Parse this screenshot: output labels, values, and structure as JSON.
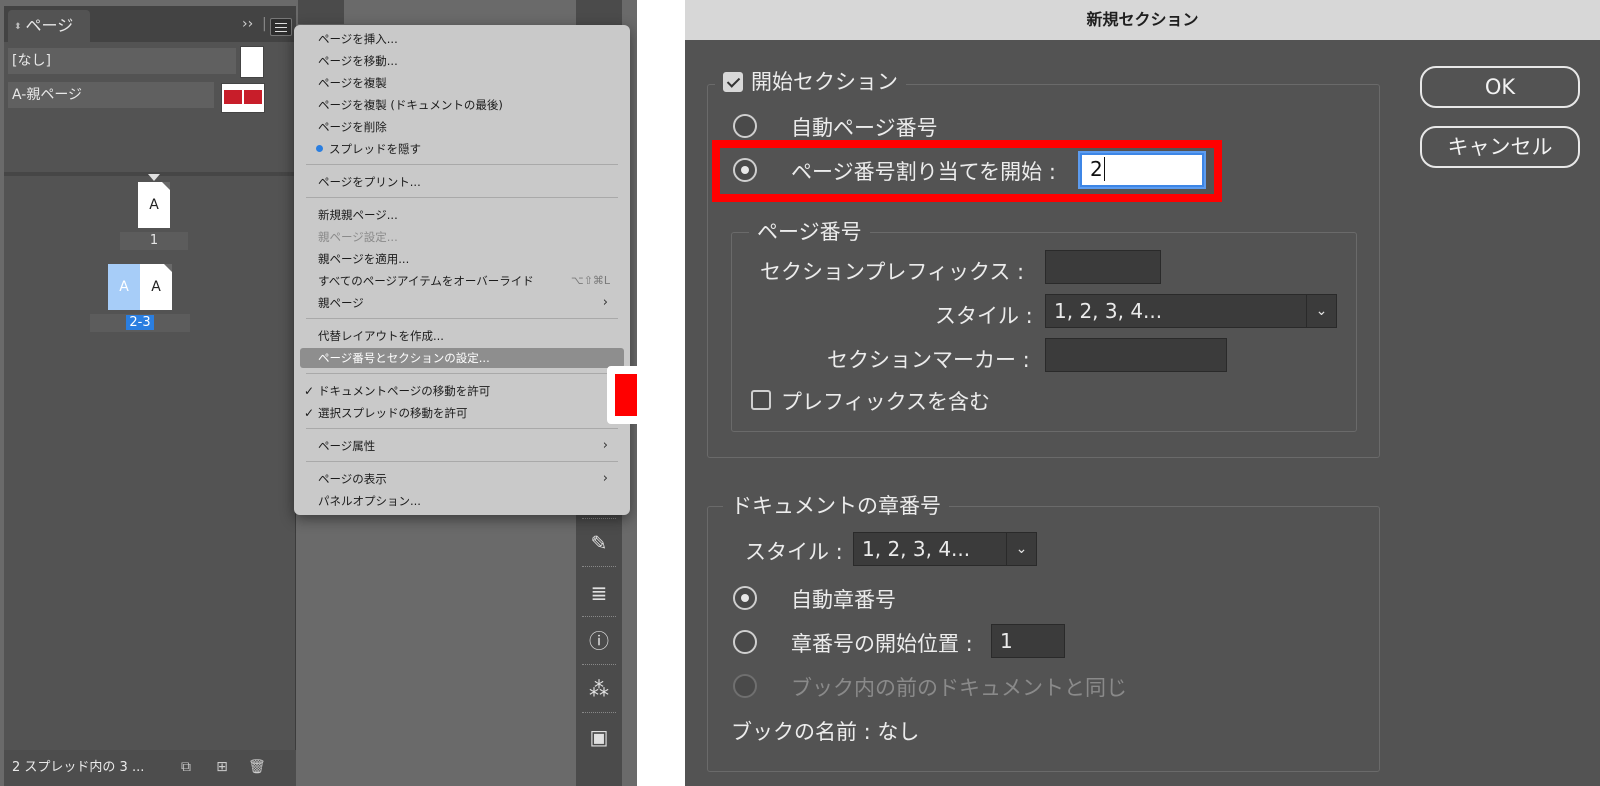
{
  "pages_panel": {
    "tab_label": "ページ",
    "parent_none": "[なし]",
    "parent_a": "A-親ページ",
    "page1_letter": "A",
    "page1_label": "1",
    "spread_left_letter": "A",
    "spread_right_letter": "A",
    "spread_label": "2-3",
    "status_text": "2 スプレッド内の 3 ..."
  },
  "context_menu": {
    "insert_pages": "ページを挿入...",
    "move_pages": "ページを移動...",
    "duplicate_pages": "ページを複製",
    "duplicate_pages_end": "ページを複製 (ドキュメントの最後)",
    "delete_pages": "ページを削除",
    "hide_spread": "スプレッドを隠す",
    "print_pages": "ページをプリント...",
    "new_parent": "新規親ページ...",
    "parent_options": "親ページ設定...",
    "apply_parent": "親ページを適用...",
    "override_all": "すべてのページアイテムをオーバーライド",
    "override_shortcut": "⌥⇧⌘L",
    "parent_pages": "親ページ",
    "alt_layout": "代替レイアウトを作成...",
    "numbering_section": "ページ番号とセクションの設定...",
    "allow_doc_move": "ドキュメントページの移動を許可",
    "allow_spread_move": "選択スプレッドの移動を許可",
    "page_attributes": "ページ属性",
    "view_pages": "ページの表示",
    "panel_options": "パネルオプション..."
  },
  "dialog": {
    "title": "新規セクション",
    "start_section": "開始セクション",
    "auto_page_numbering": "自動ページ番号",
    "start_page_numbering_at": "ページ番号割り当てを開始 :",
    "start_page_value": "2",
    "page_numbering_group": "ページ番号",
    "section_prefix_label": "セクションプレフィックス :",
    "section_prefix_value": "",
    "style_label": "スタイル :",
    "style_value": "1, 2, 3, 4...",
    "section_marker_label": "セクションマーカー :",
    "section_marker_value": "",
    "include_prefix": "プレフィックスを含む",
    "chapter_group": "ドキュメントの章番号",
    "chapter_style_label": "スタイル :",
    "chapter_style_value": "1, 2, 3, 4...",
    "auto_chapter": "自動章番号",
    "start_chapter_at": "章番号の開始位置 :",
    "start_chapter_value": "1",
    "same_as_previous": "ブック内の前のドキュメントと同じ",
    "book_name": "ブックの名前 : なし",
    "ok": "OK",
    "cancel": "キャンセル"
  },
  "colors": {
    "highlight_box": "#ff0000",
    "selection_blue": "#2a7ee0"
  }
}
